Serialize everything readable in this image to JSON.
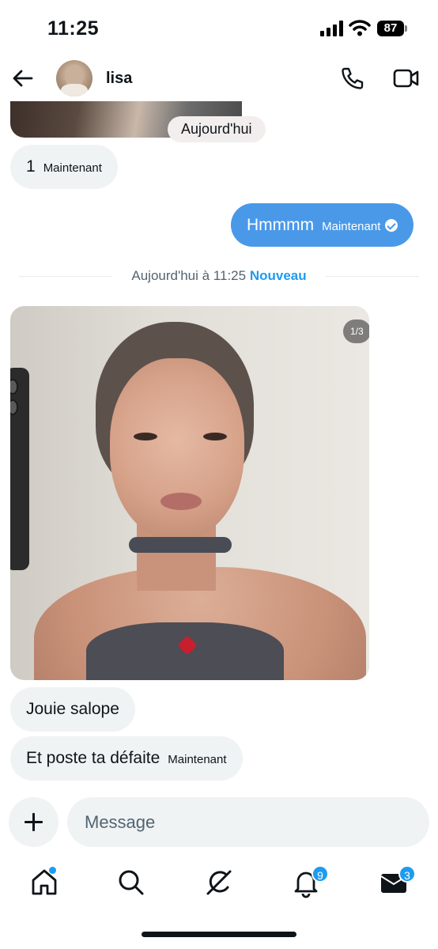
{
  "status_bar": {
    "time": "11:25",
    "battery": "87"
  },
  "header": {
    "contact_name": "lisa"
  },
  "chat": {
    "date_chip": "Aujourd'hui",
    "messages": [
      {
        "text": "1",
        "timestamp": "Maintenant",
        "direction": "incoming"
      },
      {
        "text": "Hmmmm",
        "timestamp": "Maintenant",
        "direction": "outgoing",
        "status": "read-check-icon"
      }
    ],
    "divider": {
      "label": "Aujourd'hui à 11:25",
      "new_label": "Nouveau"
    },
    "image_message": {
      "counter": "1/3"
    },
    "messages_after": [
      {
        "text": "Jouie salope",
        "direction": "incoming"
      },
      {
        "text": "Et poste ta défaite",
        "timestamp": "Maintenant",
        "direction": "incoming"
      }
    ]
  },
  "composer": {
    "placeholder": "Message"
  },
  "tab_bar": {
    "items": [
      {
        "icon": "home-icon"
      },
      {
        "icon": "search-icon"
      },
      {
        "icon": "grok-icon"
      },
      {
        "icon": "notifications-icon",
        "badge": "9"
      },
      {
        "icon": "messages-icon",
        "badge": "3"
      }
    ]
  },
  "colors": {
    "accent": "#1d9bf0",
    "outgoing_bubble": "#4a99e9",
    "incoming_bubble": "#eff3f4"
  }
}
